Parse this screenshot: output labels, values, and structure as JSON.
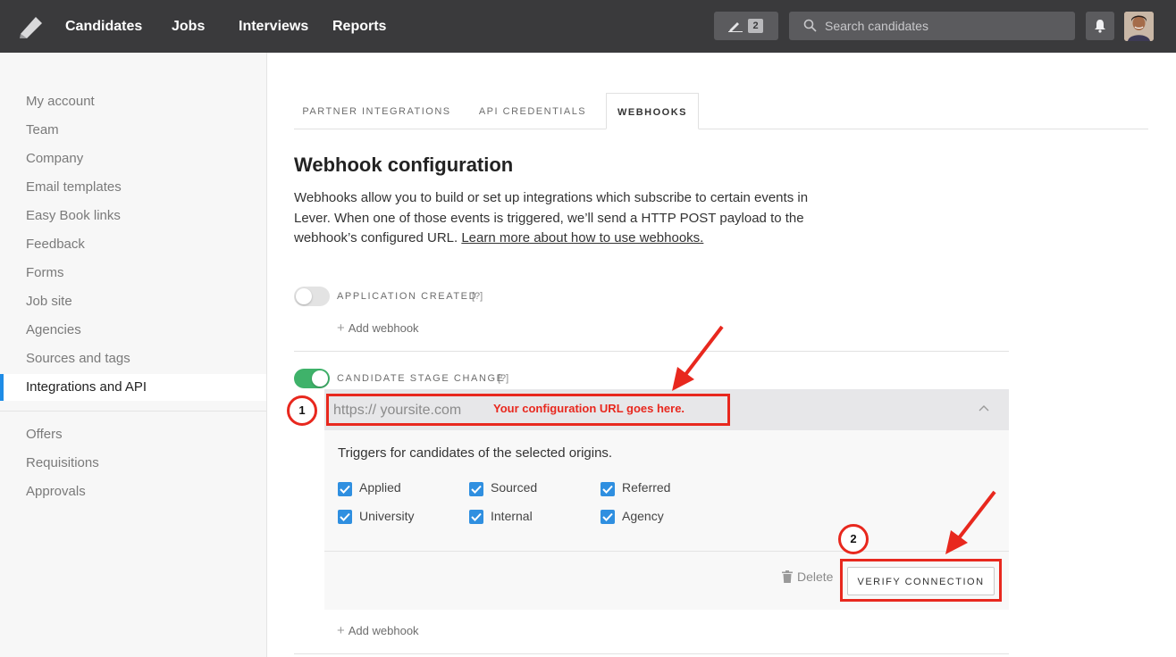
{
  "topnav": {
    "items": [
      {
        "label": "Candidates"
      },
      {
        "label": "Jobs"
      },
      {
        "label": "Interviews"
      },
      {
        "label": "Reports"
      }
    ],
    "notes_count": "2",
    "search_placeholder": "Search candidates"
  },
  "sidebar": {
    "items": [
      {
        "label": "My account"
      },
      {
        "label": "Team"
      },
      {
        "label": "Company"
      },
      {
        "label": "Email templates"
      },
      {
        "label": "Easy Book links"
      },
      {
        "label": "Feedback"
      },
      {
        "label": "Forms"
      },
      {
        "label": "Job site"
      },
      {
        "label": "Agencies"
      },
      {
        "label": "Sources and tags"
      },
      {
        "label": "Integrations and API"
      }
    ],
    "secondary_items": [
      {
        "label": "Offers"
      },
      {
        "label": "Requisitions"
      },
      {
        "label": "Approvals"
      }
    ],
    "active": "Integrations and API"
  },
  "tabs": [
    {
      "label": "PARTNER INTEGRATIONS"
    },
    {
      "label": "API CREDENTIALS"
    },
    {
      "label": "WEBHOOKS"
    }
  ],
  "active_tab": "WEBHOOKS",
  "page": {
    "title": "Webhook configuration",
    "description": "Webhooks allow you to build or set up integrations which subscribe to certain events in Lever. When one of those events is triggered, we’ll send a HTTP POST payload to the webhook’s configured URL.",
    "learn_more_link": "Learn more about how to use webhooks."
  },
  "events": [
    {
      "label": "APPLICATION CREATED",
      "help": "[?]",
      "enabled": false,
      "add_label": "Add webhook"
    },
    {
      "label": "CANDIDATE STAGE CHANGE",
      "help": "[?]",
      "enabled": true,
      "add_label": "Add webhook"
    }
  ],
  "webhook": {
    "url_placeholder": "https:// yoursite.com",
    "triggers_text": "Triggers for candidates of the selected origins.",
    "origins": [
      {
        "label": "Applied",
        "checked": true
      },
      {
        "label": "Sourced",
        "checked": true
      },
      {
        "label": "Referred",
        "checked": true
      },
      {
        "label": "University",
        "checked": true
      },
      {
        "label": "Internal",
        "checked": true
      },
      {
        "label": "Agency",
        "checked": true
      }
    ],
    "delete_label": "Delete",
    "verify_label": "VERIFY CONNECTION"
  },
  "annotations": {
    "url_note": "Your configuration URL goes here.",
    "step1": "1",
    "step2": "2",
    "color": "#e8281e"
  },
  "colors": {
    "topbar": "#3a3a3c",
    "toggle_on": "#3fb26a",
    "checkbox": "#2f8fe0",
    "active_bar": "#1f8ce6"
  }
}
